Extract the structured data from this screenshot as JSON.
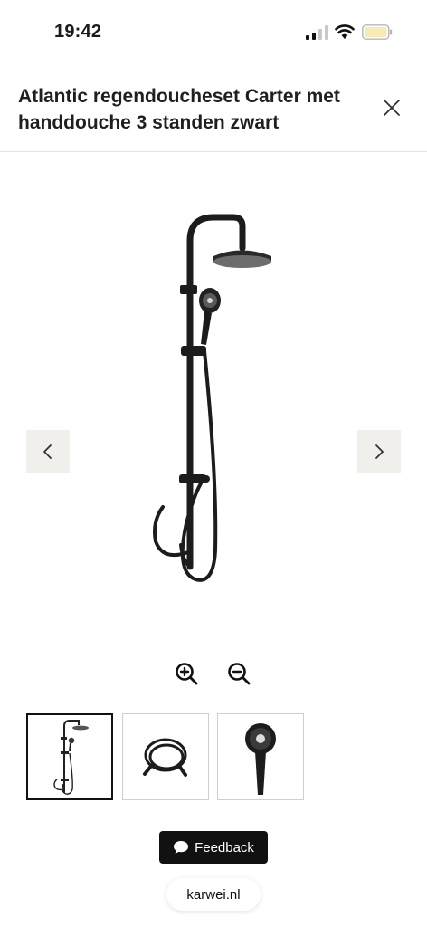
{
  "status_bar": {
    "time": "19:42",
    "icons": [
      "signal-icon",
      "wifi-icon",
      "battery-icon"
    ]
  },
  "product": {
    "title": "Atlantic regendoucheset Carter met handdouche 3 standen zwart"
  },
  "gallery": {
    "thumbnails": [
      "shower-set-thumbnail",
      "hose-thumbnail",
      "hand-shower-thumbnail"
    ],
    "selected_index": 0
  },
  "icons": {
    "close": "close-icon",
    "prev": "chevron-left-icon",
    "next": "chevron-right-icon",
    "zoom_in": "zoom-in-icon",
    "zoom_out": "zoom-out-icon",
    "feedback": "chat-bubble-icon"
  },
  "feedback": {
    "label": "Feedback"
  },
  "browser": {
    "domain": "karwei.nl"
  },
  "colors": {
    "nav_button_bg": "#f1efeb",
    "feedback_bg": "#111111",
    "product_black": "#1c1c1c"
  }
}
